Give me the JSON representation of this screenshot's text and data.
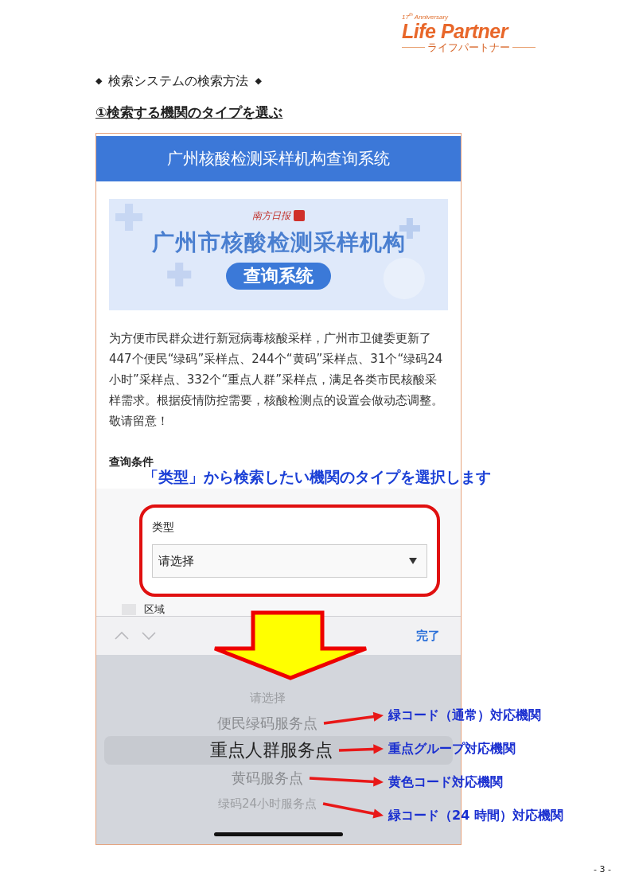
{
  "logo": {
    "anniversary": "17$^{th}$ Anniversary",
    "name": "Life Partner",
    "subtitle": "ライフパートナー"
  },
  "heading": {
    "bullet_left": "◆",
    "text": "検索システムの検索方法",
    "bullet_right": "◆"
  },
  "step_title": "①検索する機関のタイプを選ぶ",
  "phone": {
    "title": "广州核酸检测采样机构查询系统",
    "banner": {
      "brand": "南方日报",
      "title": "广州市核酸检测采样机构",
      "pill": "查询系统"
    },
    "intro": "为方便市民群众进行新冠病毒核酸采样，广州市卫健委更新了447个便民“绿码”采样点、244个“黄码”采样点、31个“绿码24小时”采样点、332个“重点人群”采样点，满足各类市民核酸采样需求。根据疫情防控需要，核酸检测点的设置会做动态调整。敬请留意！",
    "section_label": "查询条件",
    "field": {
      "label": "类型",
      "value": "请选择"
    },
    "next_field": {
      "label": "区域"
    },
    "toolbar": {
      "done": "完了"
    },
    "picker": [
      {
        "label": "请选择",
        "selected": false
      },
      {
        "label": "便民绿码服务点",
        "selected": false,
        "note": "緑コード（通常）対応機関"
      },
      {
        "label": "重点人群服务点",
        "selected": true,
        "note": "重点グループ対応機関"
      },
      {
        "label": "黄码服务点",
        "selected": false,
        "note": "黄色コード対応機関"
      },
      {
        "label": "绿码24小时服务点",
        "selected": false,
        "note": "緑コード（24 時間）対応機関"
      }
    ]
  },
  "annotations": {
    "callout": "「类型」から検索したい機関のタイプを選択します"
  },
  "page_number": "- 3 -"
}
